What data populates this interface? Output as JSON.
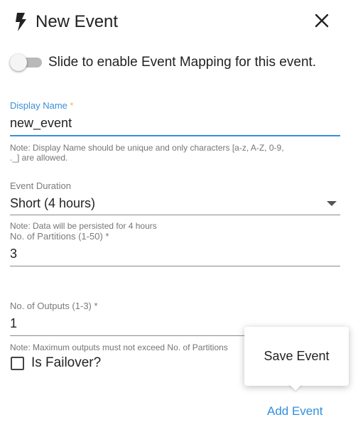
{
  "header": {
    "icon": "lightning-bolt-icon",
    "title": "New Event",
    "close_icon": "close-icon"
  },
  "mapping_toggle": {
    "label": "Slide to enable Event Mapping for this event.",
    "enabled": false
  },
  "display_name": {
    "label": "Display Name",
    "required_mark": "*",
    "value": "new_event",
    "note_line1": "Note: Display Name should be unique and only characters [a-z, A-Z, 0-9,",
    "note_line2": "._] are allowed."
  },
  "event_duration": {
    "label": "Event Duration",
    "value": "Short (4 hours)",
    "note": "Note: Data will be persisted for 4 hours"
  },
  "partitions": {
    "label": "No. of Partitions (1-50) *",
    "value": "3"
  },
  "outputs": {
    "label": "No. of Outputs (1-3) *",
    "value": "1",
    "note": "Note: Maximum outputs must not exceed No. of Partitions"
  },
  "failover": {
    "label": "Is Failover?",
    "checked": false
  },
  "popover": {
    "save_label": "Save Event"
  },
  "footer": {
    "add_event_label": "Add Event"
  },
  "colors": {
    "accent": "#3a8fd6",
    "link": "#2f8fe0",
    "required": "#f0b94c"
  }
}
